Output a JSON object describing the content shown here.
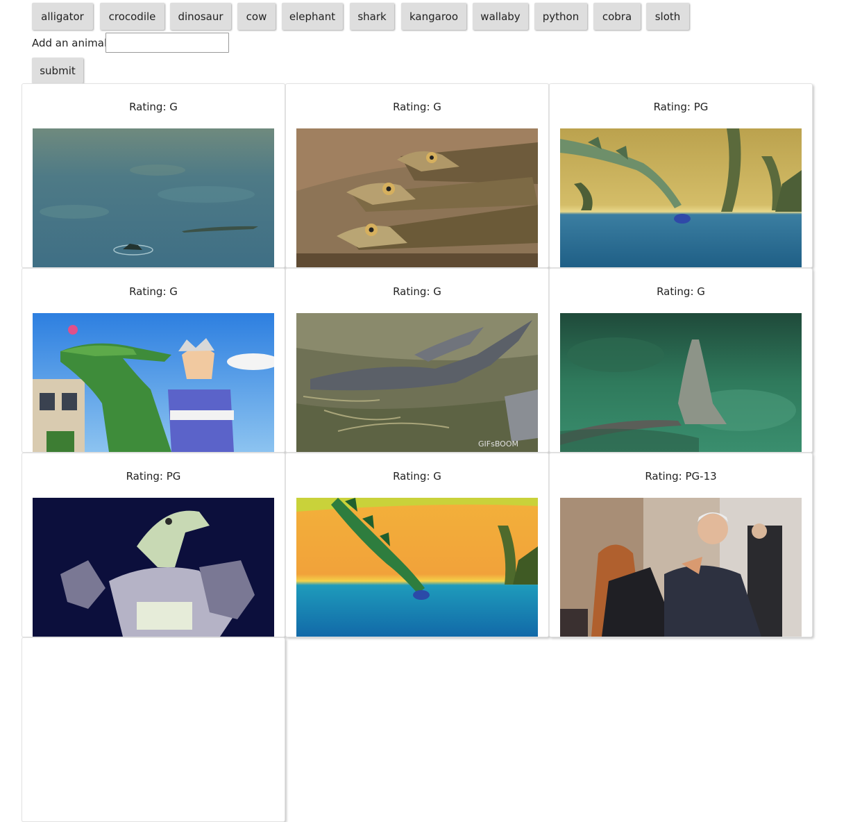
{
  "animals": [
    "alligator",
    "crocodile",
    "dinosaur",
    "cow",
    "elephant",
    "shark",
    "kangaroo",
    "wallaby",
    "python",
    "cobra",
    "sloth"
  ],
  "form": {
    "label": "Add an animal",
    "input_value": "",
    "input_placeholder": "",
    "submit_label": "submit"
  },
  "gifs": [
    {
      "rating": "Rating: G"
    },
    {
      "rating": "Rating: G"
    },
    {
      "rating": "Rating: PG"
    },
    {
      "rating": "Rating: G"
    },
    {
      "rating": "Rating: G"
    },
    {
      "rating": "Rating: G"
    },
    {
      "rating": "Rating: PG"
    },
    {
      "rating": "Rating: G"
    },
    {
      "rating": "Rating: PG-13"
    }
  ]
}
